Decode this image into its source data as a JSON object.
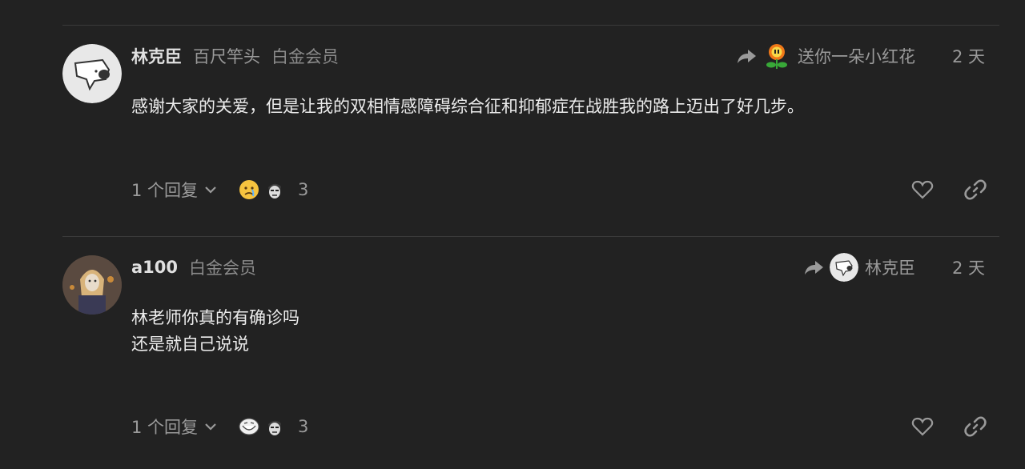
{
  "posts": [
    {
      "username": "林克臣",
      "user_title": "百尺竿头",
      "flair": "白金会员",
      "reply_to_text": "送你一朵小红花",
      "reply_to_icon": "fire-flower-icon",
      "date": "2 天",
      "content_lines": [
        "感谢大家的关爱，但是让我的双相情感障碍综合征和抑郁症在战胜我的路上迈出了好几步。"
      ],
      "replies_label": "1 个回复",
      "reactions": [
        "crying-face-emoji",
        "man-face-emoji"
      ],
      "reaction_count": "3"
    },
    {
      "username": "a100",
      "user_title": "",
      "flair": "白金会员",
      "reply_to_text": "林克臣",
      "reply_to_icon": "user-avatar-icon",
      "date": "2 天",
      "content_lines": [
        "林老师你真的有确诊吗",
        "还是就自己说说"
      ],
      "replies_label": "1 个回复",
      "reactions": [
        "trollface-emoji",
        "man-face-emoji"
      ],
      "reaction_count": "3"
    }
  ],
  "colors": {
    "background": "#222222",
    "muted": "#9a9a9a",
    "divider": "#3a3a3a"
  }
}
